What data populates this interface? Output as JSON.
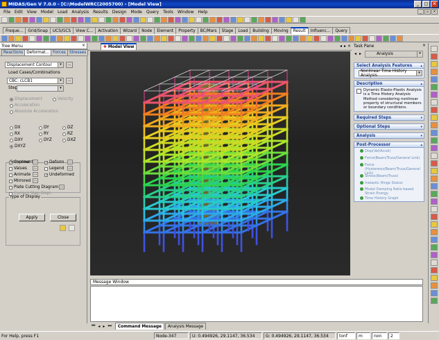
{
  "window": {
    "title": "MIDAS/Gen V 7.0.0 - [C:\\ModelWRC(2005700) - [Model View]"
  },
  "menu": [
    "File",
    "Edit",
    "View",
    "Model",
    "Load",
    "Analysis",
    "Results",
    "Design",
    "Mode",
    "Query",
    "Tools",
    "Window",
    "Help"
  ],
  "tabs_top": [
    "Freque...",
    "Grid/Snap",
    "UCS/GCS",
    "View C...",
    "Activation",
    "Wizard",
    "Node",
    "Element",
    "Property",
    "BC/Mars",
    "Stage",
    "Load",
    "Building",
    "Moving",
    "Result",
    "Influenc...",
    "Query"
  ],
  "tree_menu": {
    "title": "Tree Menu",
    "tabs": [
      "Reactions",
      "Deformat...",
      "Forces",
      "Stresses"
    ],
    "result_type": "Displacement Contour",
    "load_cases_label": "Load Cases/Combinations",
    "load_case": "CBC: cLCB1",
    "step_label": "Step",
    "modes": [
      "Displacement",
      "Velocity",
      "Acceleration",
      "Absolute Acceleration"
    ],
    "components_label": "Components",
    "components": [
      "DX",
      "DY",
      "DZ",
      "RX",
      "RY",
      "RZ",
      "DXY",
      "DYZ",
      "DXZ",
      "DXYZ"
    ],
    "type_label": "Type of Display",
    "display_options": [
      "Contour",
      "Deform",
      "Values",
      "Legend",
      "Animate",
      "Undeformed",
      "Mirrored",
      "Plate Cutting Diagram",
      "Current Step Displ."
    ],
    "apply": "Apply",
    "close": "Close"
  },
  "view": {
    "tab": "Model View"
  },
  "task_pane": {
    "title": "Task Pane",
    "dropdown": "Analysis",
    "select_features": "Select Analysis Features",
    "analysis_type": "Nonlinear Time History Analysis",
    "description_label": "Description",
    "description": "Dynamic Elasto-Plastic Analysis is a Time History Analysis Method considering nonlinear property of structural members or boundary conditions.",
    "required_steps": "Required Steps",
    "optional_steps": "Optional Steps",
    "analysis": "Analysis",
    "post_processor": "Post-Processor",
    "post_items": [
      "Disp(Vel/Accel)",
      "Force(Beam/Truss/General Link)",
      "Force (Hysteresis/Beam/Truss/General Link)",
      "Stress(Beam/Truss)",
      "Inelastic Hinge Status",
      "Modal Damping Ratio based Strain Energy",
      "Time History Graph"
    ]
  },
  "message": {
    "title": "Message Window",
    "tabs": [
      "Command Message",
      "Analysis Message"
    ]
  },
  "status": {
    "help": "For Help, press F1",
    "node": "Node-347",
    "u": "U: 0.494926, 29.1147, 36.534",
    "g": "G: 0.494926, 29.1147, 36.534",
    "unit1": "tonf",
    "unit2": "m",
    "none": "non",
    "page": "2"
  },
  "colors": {
    "title_bar": "#0d47c7",
    "highlight": "#4a6ad0"
  }
}
